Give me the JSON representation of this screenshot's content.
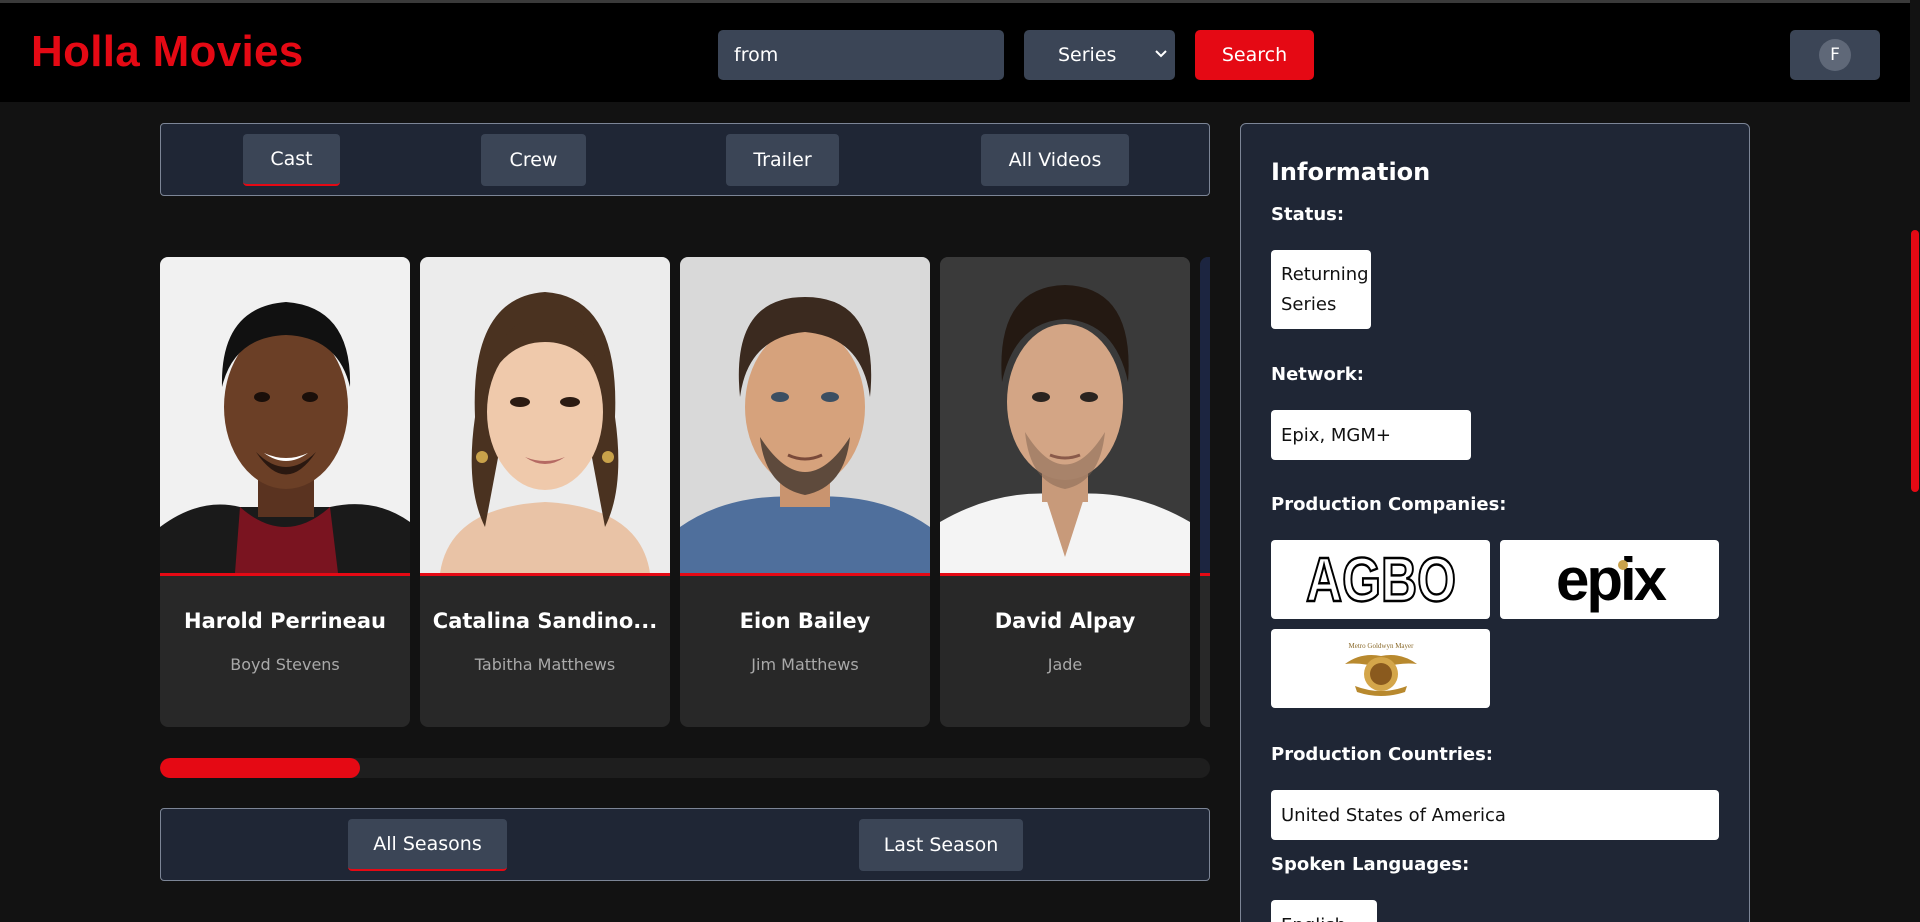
{
  "header": {
    "logo": "Holla Movies",
    "search": {
      "value": "from",
      "placeholder": ""
    },
    "type_select": {
      "selected": "Series"
    },
    "search_button": "Search",
    "profile": {
      "initial": "F"
    }
  },
  "media_tabs": [
    {
      "label": "Cast",
      "active": true
    },
    {
      "label": "Crew",
      "active": false
    },
    {
      "label": "Trailer",
      "active": false
    },
    {
      "label": "All Videos",
      "active": false
    }
  ],
  "cast": [
    {
      "name": "Harold Perrineau",
      "character": "Boyd Stevens"
    },
    {
      "name": "Catalina Sandino...",
      "character": "Tabitha Matthews"
    },
    {
      "name": "Eion Bailey",
      "character": "Jim Matthews"
    },
    {
      "name": "David Alpay",
      "character": "Jade"
    }
  ],
  "cast_scroll_progress": 0.19,
  "season_tabs": [
    {
      "label": "All Seasons",
      "active": true
    },
    {
      "label": "Last Season",
      "active": false
    }
  ],
  "information": {
    "title": "Information",
    "status_label": "Status:",
    "status_value_line1": "Returning",
    "status_value_line2": "Series",
    "network_label": "Network:",
    "network_value": "Epix, MGM+",
    "companies_label": "Production Companies:",
    "companies": [
      {
        "name": "AGBO",
        "logo_text": "AGBO"
      },
      {
        "name": "Epix",
        "logo_text": "epix"
      },
      {
        "name": "Metro-Goldwyn-Mayer",
        "logo_text": "Metro Goldwyn Mayer"
      }
    ],
    "countries_label": "Production Countries:",
    "countries_value": "United States of America",
    "languages_label": "Spoken Languages:",
    "languages_value": "English"
  },
  "colors": {
    "accent": "#e50914",
    "background": "#121212",
    "panel": "#1f2635",
    "button": "#3b4556"
  }
}
